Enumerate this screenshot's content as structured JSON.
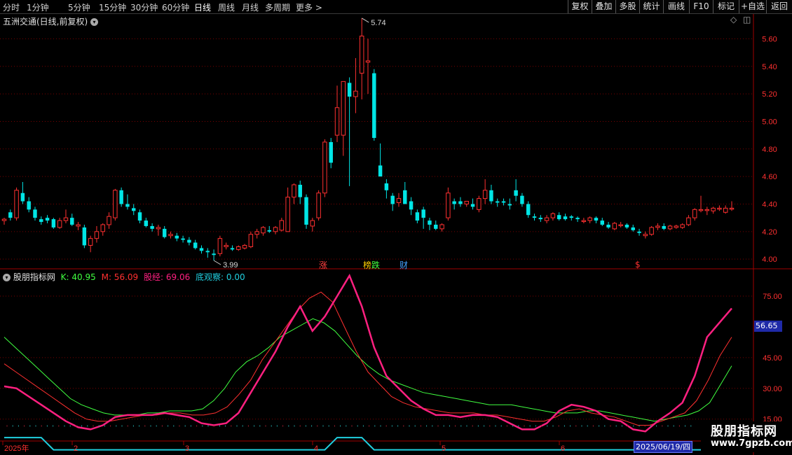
{
  "toolbar": {
    "periods": [
      "分时",
      "1分钟",
      "5分钟",
      "15分钟",
      "30分钟",
      "60分钟",
      "日线",
      "周线",
      "月线",
      "多周期",
      "更多 >"
    ],
    "active_period": "日线",
    "right_buttons": [
      "复权",
      "叠加",
      "多股",
      "统计",
      "画线",
      "F10",
      "标记",
      "+自选",
      "返回"
    ]
  },
  "header": {
    "title": "五洲交通(日线,前复权)"
  },
  "price_axis": {
    "ticks": [
      "5.60",
      "5.40",
      "5.20",
      "5.00",
      "4.80",
      "4.60",
      "4.40",
      "4.20",
      "4.00"
    ],
    "high_label": "5.74",
    "low_label": "3.99"
  },
  "event_markers": [
    {
      "text": "涨",
      "color": "#ff4040"
    },
    {
      "text": "榜",
      "color": "#ffd000"
    },
    {
      "text": "跌",
      "color": "#40ff40"
    },
    {
      "text": "财",
      "color": "#40a0ff"
    },
    {
      "text": "$",
      "color": "#ff3030"
    }
  ],
  "indicator": {
    "name": "股朋指标网",
    "k_label": "K: 40.95",
    "m_label": "M: 56.09",
    "gj_label": "股经: 69.06",
    "dgc_label": "底观察: 0.00",
    "ticks": [
      "75.00",
      "45.00",
      "30.00",
      "15.00"
    ],
    "current_badge": "56.65",
    "colors": {
      "k": "#40ff40",
      "m": "#ff3030",
      "gj": "#ff2080",
      "dgc": "#20d0e0"
    }
  },
  "date_axis": {
    "labels": [
      "2025年",
      "2",
      "3",
      "4",
      "5",
      "6"
    ],
    "cursor_date": "2025/06/19/四"
  },
  "watermark": {
    "title": "股朋指标网",
    "url": "www.7gpzb.com"
  },
  "colors": {
    "up": "#ff3030",
    "down": "#00e5e5",
    "grid": "#7a0000",
    "bg": "#000000"
  },
  "chart_data": {
    "type": "candlestick",
    "x_range": [
      "2025-01",
      "2025-06-19"
    ],
    "ylim": [
      3.95,
      5.78
    ],
    "candles_ohlc": [
      [
        4.28,
        4.3,
        4.25,
        4.29
      ],
      [
        4.34,
        4.36,
        4.28,
        4.3
      ],
      [
        4.3,
        4.52,
        4.28,
        4.5
      ],
      [
        4.48,
        4.56,
        4.4,
        4.42
      ],
      [
        4.42,
        4.45,
        4.34,
        4.36
      ],
      [
        4.36,
        4.38,
        4.28,
        4.3
      ],
      [
        4.29,
        4.31,
        4.25,
        4.27
      ],
      [
        4.3,
        4.32,
        4.26,
        4.28
      ],
      [
        4.29,
        4.3,
        4.22,
        4.23
      ],
      [
        4.23,
        4.3,
        4.22,
        4.28
      ],
      [
        4.28,
        4.36,
        4.26,
        4.3
      ],
      [
        4.3,
        4.33,
        4.24,
        4.25
      ],
      [
        4.24,
        4.27,
        4.21,
        4.25
      ],
      [
        4.23,
        4.25,
        4.08,
        4.1
      ],
      [
        4.1,
        4.17,
        4.05,
        4.15
      ],
      [
        4.15,
        4.24,
        4.12,
        4.2
      ],
      [
        4.2,
        4.26,
        4.17,
        4.25
      ],
      [
        4.25,
        4.34,
        4.22,
        4.31
      ],
      [
        4.3,
        4.51,
        4.28,
        4.5
      ],
      [
        4.5,
        4.52,
        4.38,
        4.4
      ],
      [
        4.4,
        4.47,
        4.36,
        4.38
      ],
      [
        4.37,
        4.4,
        4.32,
        4.35
      ],
      [
        4.34,
        4.36,
        4.26,
        4.28
      ],
      [
        4.28,
        4.3,
        4.23,
        4.24
      ],
      [
        4.24,
        4.26,
        4.2,
        4.22
      ],
      [
        4.22,
        4.25,
        4.17,
        4.23
      ],
      [
        4.22,
        4.24,
        4.15,
        4.16
      ],
      [
        4.17,
        4.2,
        4.15,
        4.18
      ],
      [
        4.17,
        4.19,
        4.13,
        4.15
      ],
      [
        4.15,
        4.17,
        4.12,
        4.14
      ],
      [
        4.14,
        4.16,
        4.1,
        4.12
      ],
      [
        4.12,
        4.14,
        4.07,
        4.08
      ],
      [
        4.08,
        4.1,
        4.04,
        4.06
      ],
      [
        4.06,
        4.08,
        4.01,
        4.05
      ],
      [
        4.04,
        4.07,
        3.99,
        4.03
      ],
      [
        4.04,
        4.17,
        4.02,
        4.15
      ],
      [
        4.09,
        4.12,
        4.07,
        4.1
      ],
      [
        4.08,
        4.1,
        4.06,
        4.07
      ],
      [
        4.07,
        4.1,
        4.06,
        4.09
      ],
      [
        4.08,
        4.11,
        4.07,
        4.1
      ],
      [
        4.09,
        4.2,
        4.08,
        4.18
      ],
      [
        4.18,
        4.22,
        4.15,
        4.2
      ],
      [
        4.19,
        4.24,
        4.17,
        4.23
      ],
      [
        4.21,
        4.24,
        4.19,
        4.2
      ],
      [
        4.2,
        4.24,
        4.18,
        4.23
      ],
      [
        4.21,
        4.3,
        4.2,
        4.28
      ],
      [
        4.2,
        4.52,
        4.2,
        4.45
      ],
      [
        4.45,
        4.55,
        4.4,
        4.54
      ],
      [
        4.54,
        4.57,
        4.4,
        4.45
      ],
      [
        4.45,
        4.47,
        4.22,
        4.25
      ],
      [
        4.24,
        4.3,
        4.2,
        4.28
      ],
      [
        4.3,
        4.5,
        4.28,
        4.48
      ],
      [
        4.48,
        4.87,
        4.45,
        4.85
      ],
      [
        4.85,
        4.88,
        4.66,
        4.7
      ],
      [
        4.9,
        5.26,
        4.85,
        5.1
      ],
      [
        4.9,
        5.22,
        4.75,
        5.29
      ],
      [
        5.28,
        5.32,
        4.53,
        5.18
      ],
      [
        5.18,
        5.46,
        5.06,
        5.22
      ],
      [
        5.35,
        5.75,
        5.16,
        5.62
      ],
      [
        5.43,
        5.6,
        5.2,
        5.44
      ],
      [
        5.35,
        5.38,
        4.86,
        4.88
      ],
      [
        4.68,
        4.84,
        4.6,
        4.6
      ],
      [
        4.55,
        4.58,
        4.44,
        4.5
      ],
      [
        4.46,
        4.48,
        4.35,
        4.4
      ],
      [
        4.41,
        4.48,
        4.38,
        4.44
      ],
      [
        4.5,
        4.56,
        4.42,
        4.4
      ],
      [
        4.42,
        4.45,
        4.32,
        4.36
      ],
      [
        4.34,
        4.36,
        4.26,
        4.28
      ],
      [
        4.36,
        4.38,
        4.22,
        4.3
      ],
      [
        4.28,
        4.3,
        4.21,
        4.25
      ],
      [
        4.25,
        4.28,
        4.21,
        4.22
      ],
      [
        4.22,
        4.26,
        4.2,
        4.25
      ],
      [
        4.3,
        4.52,
        4.28,
        4.48
      ],
      [
        4.42,
        4.44,
        4.36,
        4.4
      ],
      [
        4.42,
        4.45,
        4.38,
        4.4
      ],
      [
        4.4,
        4.42,
        4.38,
        4.42
      ],
      [
        4.4,
        4.44,
        4.36,
        4.38
      ],
      [
        4.36,
        4.46,
        4.34,
        4.44
      ],
      [
        4.44,
        4.58,
        4.4,
        4.5
      ],
      [
        4.5,
        4.54,
        4.4,
        4.42
      ],
      [
        4.42,
        4.44,
        4.38,
        4.41
      ],
      [
        4.42,
        4.44,
        4.39,
        4.41
      ],
      [
        4.4,
        4.44,
        4.36,
        4.39
      ],
      [
        4.5,
        4.58,
        4.42,
        4.46
      ],
      [
        4.46,
        4.48,
        4.38,
        4.4
      ],
      [
        4.4,
        4.42,
        4.3,
        4.32
      ],
      [
        4.31,
        4.33,
        4.28,
        4.3
      ],
      [
        4.3,
        4.32,
        4.27,
        4.29
      ],
      [
        4.28,
        4.32,
        4.26,
        4.3
      ],
      [
        4.3,
        4.34,
        4.28,
        4.33
      ],
      [
        4.32,
        4.34,
        4.28,
        4.29
      ],
      [
        4.31,
        4.33,
        4.28,
        4.29
      ],
      [
        4.31,
        4.32,
        4.28,
        4.3
      ],
      [
        4.3,
        4.31,
        4.27,
        4.29
      ],
      [
        4.28,
        4.3,
        4.26,
        4.28
      ],
      [
        4.28,
        4.31,
        4.26,
        4.3
      ],
      [
        4.3,
        4.31,
        4.26,
        4.28
      ],
      [
        4.28,
        4.3,
        4.24,
        4.25
      ],
      [
        4.25,
        4.27,
        4.22,
        4.23
      ],
      [
        4.22,
        4.27,
        4.21,
        4.26
      ],
      [
        4.25,
        4.27,
        4.23,
        4.25
      ],
      [
        4.25,
        4.26,
        4.22,
        4.23
      ],
      [
        4.23,
        4.25,
        4.2,
        4.21
      ],
      [
        4.2,
        4.22,
        4.17,
        4.19
      ],
      [
        4.17,
        4.2,
        4.15,
        4.18
      ],
      [
        4.18,
        4.24,
        4.17,
        4.23
      ],
      [
        4.23,
        4.26,
        4.21,
        4.24
      ],
      [
        4.24,
        4.26,
        4.21,
        4.22
      ],
      [
        4.22,
        4.25,
        4.21,
        4.24
      ],
      [
        4.23,
        4.25,
        4.22,
        4.24
      ],
      [
        4.23,
        4.26,
        4.22,
        4.25
      ],
      [
        4.25,
        4.32,
        4.24,
        4.3
      ],
      [
        4.3,
        4.37,
        4.28,
        4.36
      ],
      [
        4.36,
        4.46,
        4.34,
        4.36
      ],
      [
        4.36,
        4.38,
        4.32,
        4.36
      ],
      [
        4.35,
        4.38,
        4.33,
        4.37
      ],
      [
        4.37,
        4.39,
        4.35,
        4.37
      ],
      [
        4.34,
        4.39,
        4.33,
        4.37
      ],
      [
        4.37,
        4.42,
        4.35,
        4.37
      ]
    ],
    "indicator_series": {
      "K": [
        55,
        50,
        45,
        40,
        35,
        30,
        25,
        22,
        20,
        18,
        17,
        17,
        17,
        18,
        18,
        19,
        19,
        19,
        20,
        24,
        30,
        38,
        43,
        46,
        50,
        55,
        58,
        61,
        64,
        62,
        58,
        52,
        46,
        41,
        37,
        34,
        32,
        30,
        28,
        27,
        26,
        25,
        24,
        23,
        22,
        22,
        22,
        21,
        20,
        19,
        18,
        18,
        18,
        19,
        19,
        18,
        17,
        16,
        15,
        14,
        15,
        16,
        17,
        19,
        23,
        32,
        41
      ],
      "M": [
        42,
        38,
        34,
        30,
        26,
        22,
        18,
        15,
        14,
        14,
        15,
        16,
        17,
        17,
        18,
        18,
        17,
        17,
        18,
        21,
        27,
        34,
        44,
        52,
        60,
        68,
        74,
        77,
        72,
        60,
        48,
        38,
        32,
        26,
        23,
        21,
        20,
        19,
        18,
        18,
        18,
        17,
        17,
        16,
        15,
        14,
        14,
        16,
        19,
        20,
        18,
        17,
        16,
        14,
        12,
        12,
        14,
        16,
        18,
        24,
        34,
        46,
        55
      ],
      "GJ": [
        31,
        30,
        26,
        22,
        18,
        14,
        11,
        10,
        12,
        16,
        17,
        17,
        17,
        18,
        17,
        16,
        13,
        12,
        13,
        18,
        28,
        38,
        48,
        60,
        70,
        58,
        65,
        75,
        85,
        70,
        50,
        36,
        30,
        24,
        20,
        17,
        17,
        16,
        17,
        17,
        16,
        13,
        10,
        10,
        13,
        19,
        22,
        21,
        19,
        15,
        14,
        10,
        9,
        14,
        18,
        23,
        36,
        55,
        62,
        69
      ],
      "DGC": [
        6,
        6,
        6,
        6,
        0,
        0,
        0,
        0,
        0,
        0,
        0,
        0,
        0,
        0,
        0,
        0,
        0,
        0,
        0,
        0,
        0,
        0,
        0,
        0,
        0,
        0,
        0,
        6,
        6,
        6,
        0,
        0,
        0,
        0,
        0,
        0,
        0,
        0,
        0,
        0,
        0,
        0,
        0,
        0,
        0,
        0,
        0,
        0,
        0,
        0,
        0,
        0,
        0,
        0,
        0,
        0,
        0,
        0,
        0,
        0
      ]
    }
  }
}
